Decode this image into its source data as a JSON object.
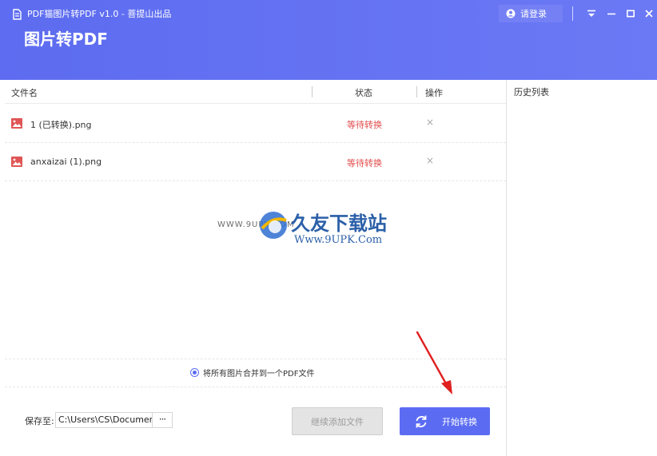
{
  "window": {
    "title": "PDF猫图片转PDF v1.0 - 菩提山出品",
    "heading": "图片转PDF",
    "login_label": "请登录"
  },
  "table": {
    "col_name": "文件名",
    "col_status": "状态",
    "col_action": "操作",
    "rows": [
      {
        "name": "1 (已转换).png",
        "status": "等待转换",
        "remove": "×"
      },
      {
        "name": "anxaizai (1).png",
        "status": "等待转换",
        "remove": "×"
      }
    ]
  },
  "watermark": {
    "small": "WWW.9UPK.COM",
    "cn": "久友下载站",
    "url": "Www.9UPK.Com"
  },
  "merge": {
    "label": "将所有图片合并到一个PDF文件",
    "checked": true
  },
  "footer": {
    "save_label": "保存至:",
    "save_path": "C:\\Users\\CS\\Documents",
    "browse_label": "···",
    "add_more_label": "继续添加文件",
    "start_label": "开始转换"
  },
  "history": {
    "title": "历史列表"
  },
  "colors": {
    "header": "#5d6cf0",
    "accent": "#5b6cf3",
    "status": "#e24c4c",
    "image_icon": "#e05555",
    "annotation_arrow": "#e02020"
  }
}
